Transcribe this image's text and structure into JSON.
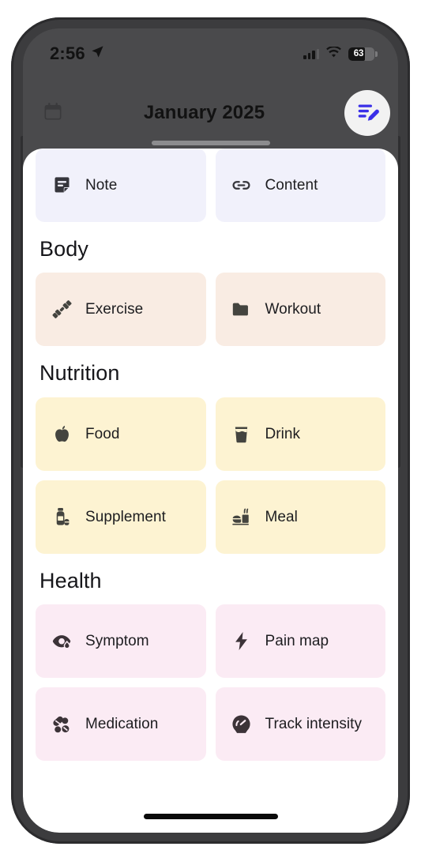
{
  "status_bar": {
    "time": "2:56",
    "location_icon": "location-arrow-icon",
    "cellular_icon": "cellular-bars-icon",
    "wifi_icon": "wifi-icon",
    "battery_percent": "63",
    "battery_icon": "battery-icon"
  },
  "header": {
    "title": "January 2025",
    "calendar_icon": "calendar-icon",
    "edit_fab_icon": "edit-list-icon",
    "accent_color": "#3a2fe8"
  },
  "sheet": {
    "grabber": "sheet-grabber",
    "sections": [
      {
        "id": "top",
        "title": "",
        "tile_class": "t-note",
        "icon_class": "icon-dark-note",
        "tiles": [
          {
            "label": "Note",
            "icon": "note-icon"
          },
          {
            "label": "Content",
            "icon": "link-icon"
          }
        ]
      },
      {
        "id": "body",
        "title": "Body",
        "tile_class": "t-body",
        "icon_class": "icon-dark",
        "tiles": [
          {
            "label": "Exercise",
            "icon": "dumbbell-icon"
          },
          {
            "label": "Workout",
            "icon": "folder-icon"
          }
        ]
      },
      {
        "id": "nutrition",
        "title": "Nutrition",
        "tile_class": "t-nutri",
        "icon_class": "icon-dark",
        "tiles": [
          {
            "label": "Food",
            "icon": "apple-icon"
          },
          {
            "label": "Drink",
            "icon": "glass-icon"
          },
          {
            "label": "Supplement",
            "icon": "supplement-bottle-icon"
          },
          {
            "label": "Meal",
            "icon": "meal-bowl-icon"
          }
        ]
      },
      {
        "id": "health",
        "title": "Health",
        "tile_class": "t-health",
        "icon_class": "icon-dark-health",
        "tiles": [
          {
            "label": "Symptom",
            "icon": "eye-drop-icon"
          },
          {
            "label": "Pain map",
            "icon": "bolt-icon"
          },
          {
            "label": "Medication",
            "icon": "pills-icon"
          },
          {
            "label": "Track intensity",
            "icon": "gauge-icon"
          }
        ]
      }
    ]
  },
  "colors": {
    "note_tile": "#f1f1fb",
    "body_tile": "#f9ece3",
    "nutrition_tile": "#fdf3d2",
    "health_tile": "#fbebf4",
    "sheet_bg": "#ffffff",
    "phone_body": "#3c3c3e"
  },
  "home_indicator": "home-indicator"
}
